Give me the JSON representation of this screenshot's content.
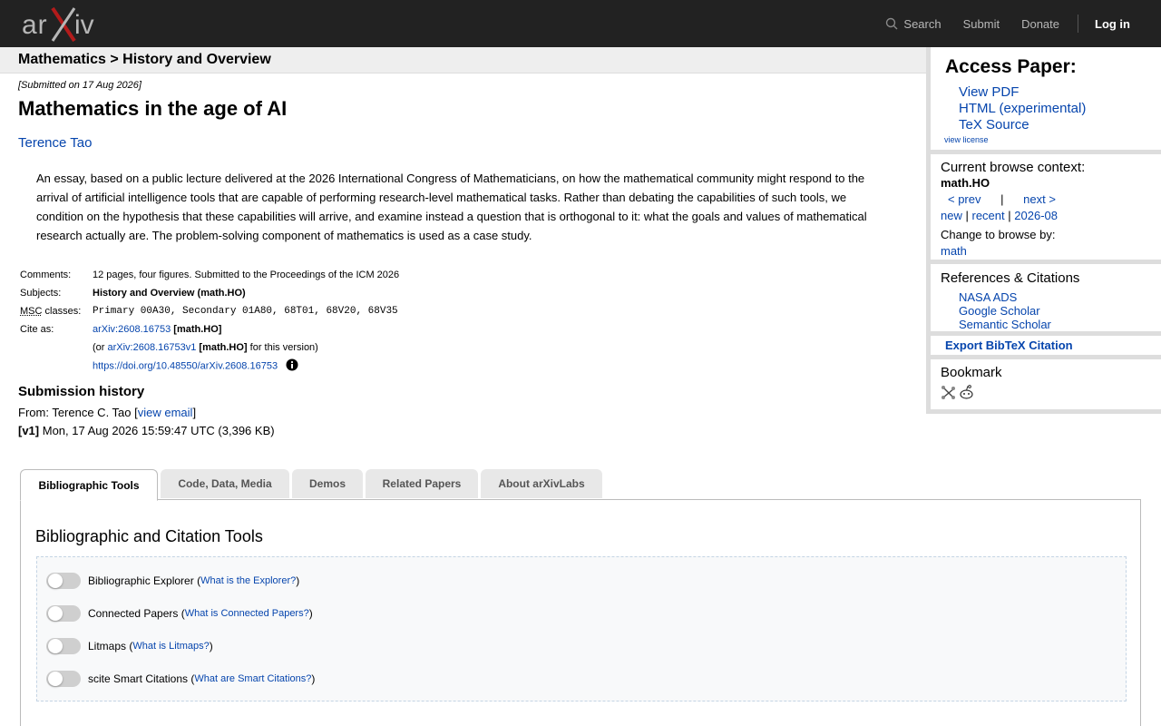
{
  "header": {
    "logo_text": "arXiv",
    "nav": {
      "search": "Search",
      "submit": "Submit",
      "donate": "Donate",
      "login": "Log in"
    }
  },
  "breadcrumb": {
    "text": "Mathematics > History and Overview"
  },
  "paper": {
    "submitted": "[Submitted on 17 Aug 2026]",
    "title": "Mathematics in the age of AI",
    "author": "Terence Tao",
    "abstract": "An essay, based on a public lecture delivered at the 2026 International Congress of Mathematicians, on how the mathematical community might respond to the arrival of artificial intelligence tools that are capable of performing research-level mathematical tasks. Rather than debating the capabilities of such tools, we condition on the hypothesis that these capabilities will arrive, and examine instead a question that is orthogonal to it: what the goals and values of mathematical research actually are. The problem-solving component of mathematics is used as a case study."
  },
  "metadata": {
    "comments_label": "Comments:",
    "comments": "12 pages, four figures. Submitted to the Proceedings of the ICM 2026",
    "subjects_label": "Subjects:",
    "subjects": "History and Overview (math.HO)",
    "msc_abbr": "MSC",
    "msc_label": " classes:",
    "msc": "Primary 00A30, Secondary 01A80, 68T01, 68V20, 68V35",
    "cite_label": "Cite as:",
    "cite_id": "arXiv:2608.16753",
    "cite_cat": "[math.HO]",
    "cite_or": "(or ",
    "cite_v1": "arXiv:2608.16753v1",
    "cite_v1_cat": "[math.HO]",
    "cite_v1_suffix": " for this version)",
    "doi": "https://doi.org/10.48550/arXiv.2608.16753"
  },
  "submission_history": {
    "title": "Submission history",
    "from_prefix": "From: Terence C. Tao [",
    "view_email": "view email",
    "from_suffix": "]",
    "v1_label": "[v1]",
    "v1_text": " Mon, 17 Aug 2026 15:59:47 UTC (3,396 KB)"
  },
  "sidebar": {
    "access_title": "Access Paper:",
    "access_links": [
      "View PDF",
      "HTML (experimental)",
      "TeX Source"
    ],
    "view_license": "view license",
    "browse_title": "Current browse context:",
    "browse_context": "math.HO",
    "prev": "< prev",
    "sep": "|",
    "next": "next >",
    "new": "new",
    "recent": "recent",
    "month": "2026-08",
    "change_browse": "Change to browse by:",
    "math": "math",
    "refs_title": "References & Citations",
    "refs_links": [
      "NASA ADS",
      "Google Scholar",
      "Semantic Scholar"
    ],
    "export_bibtex": "Export BibTeX Citation",
    "bookmark_title": "Bookmark"
  },
  "tabs": [
    "Bibliographic Tools",
    "Code, Data, Media",
    "Demos",
    "Related Papers",
    "About arXivLabs"
  ],
  "panel": {
    "title": "Bibliographic and Citation Tools",
    "tools": [
      {
        "label": "Bibliographic Explorer",
        "link": "What is the Explorer?"
      },
      {
        "label": "Connected Papers",
        "link": "What is Connected Papers?"
      },
      {
        "label": "Litmaps",
        "link": "What is Litmaps?"
      },
      {
        "label": "scite Smart Citations",
        "link": "What are Smart Citations?"
      }
    ]
  },
  "colors": {
    "header_bg": "#222222",
    "logo_x": "#b31b1b",
    "link": "#0645ad"
  }
}
